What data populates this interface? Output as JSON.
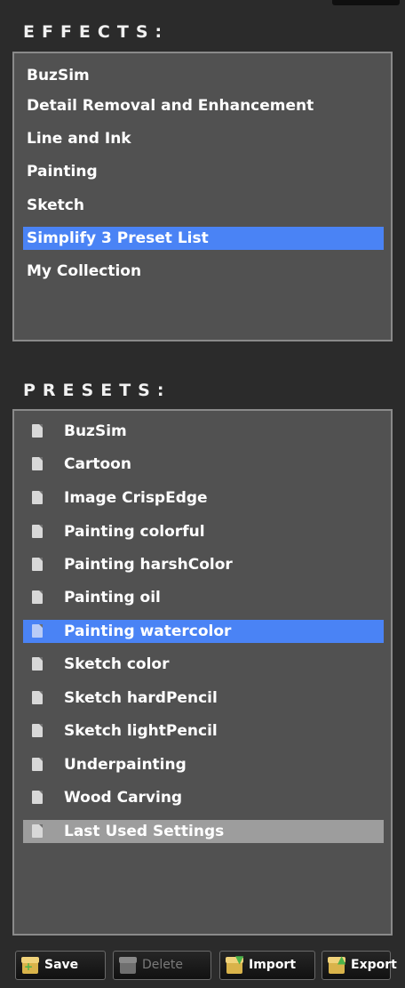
{
  "effects": {
    "title": "EFFECTS:",
    "items": [
      {
        "label": "BuzSim"
      },
      {
        "label": "Detail Removal and Enhancement"
      },
      {
        "label": "Line and Ink"
      },
      {
        "label": "Painting"
      },
      {
        "label": "Sketch"
      },
      {
        "label": "Simplify 3 Preset List",
        "selected": true
      },
      {
        "label": "My Collection"
      }
    ]
  },
  "presets": {
    "title": "PRESETS:",
    "items": [
      {
        "label": "BuzSim"
      },
      {
        "label": "Cartoon"
      },
      {
        "label": "Image CrispEdge"
      },
      {
        "label": "Painting colorful"
      },
      {
        "label": "Painting harshColor"
      },
      {
        "label": "Painting oil"
      },
      {
        "label": "Painting watercolor",
        "selected": true
      },
      {
        "label": "Sketch color"
      },
      {
        "label": "Sketch hardPencil"
      },
      {
        "label": "Sketch lightPencil"
      },
      {
        "label": "Underpainting"
      },
      {
        "label": "Wood Carving"
      },
      {
        "label": "Last Used Settings",
        "last_used": true
      }
    ]
  },
  "toolbar": {
    "save_label": "Save",
    "delete_label": "Delete",
    "import_label": "Import",
    "export_label": "Export"
  },
  "colors": {
    "selection": "#4a83f5",
    "last_used_highlight": "#9d9d9d",
    "panel_bg": "#515151",
    "window_bg": "#2b2b2b"
  }
}
